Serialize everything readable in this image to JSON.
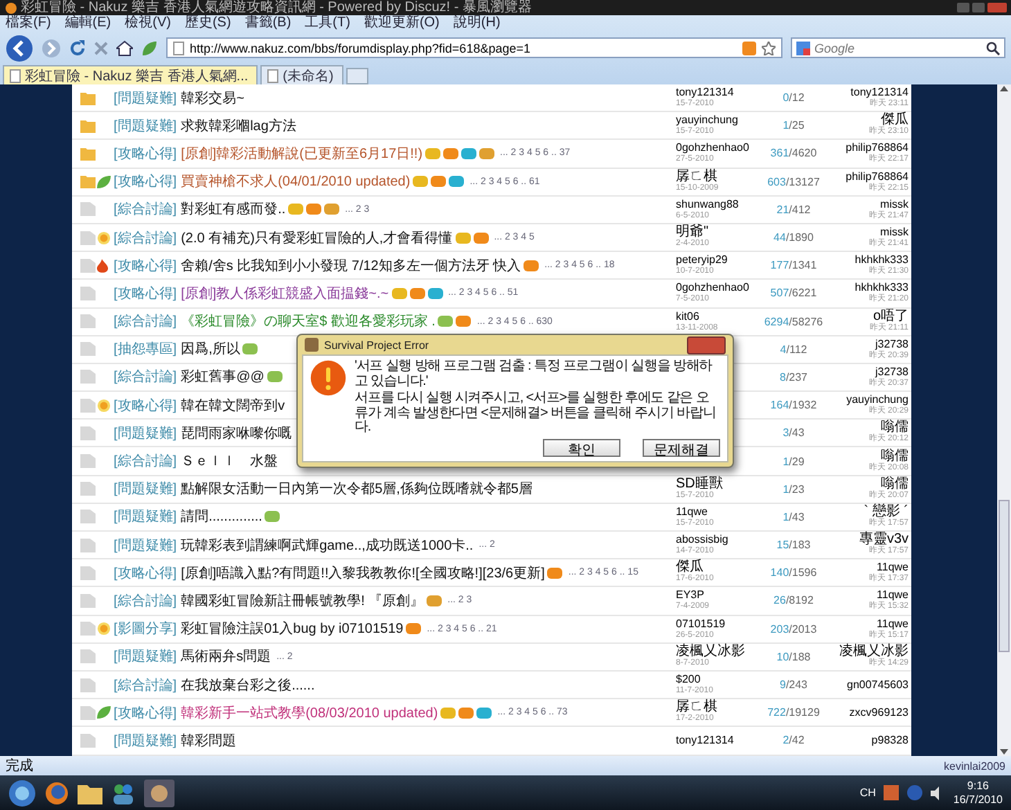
{
  "window": {
    "title": "彩虹冒險 - Nakuz 樂吉 香港人氣網遊攻略資訊網 - Powered by Discuz! - 暴風瀏覽器"
  },
  "menu": [
    "檔案(F)",
    "編輯(E)",
    "檢視(V)",
    "歷史(S)",
    "書籤(B)",
    "工具(T)",
    "歡迎更新(O)",
    "說明(H)"
  ],
  "address": {
    "value": "http://www.nakuz.com/bbs/forumdisplay.php?fid=618&page=1"
  },
  "search": {
    "placeholder": "Google"
  },
  "tabs": [
    {
      "label": "彩虹冒險 - Nakuz 樂吉 香港人氣網...",
      "selected": true
    },
    {
      "label": "(未命名)",
      "selected": false
    }
  ],
  "rows": [
    {
      "kind": "hot",
      "category": "[問題疑難]",
      "title": "韓彩交易~",
      "author": "tony121314",
      "date": "15-7-2010",
      "replies": "0",
      "views": "/12",
      "last_user": "tony121314",
      "last_time": "昨天 23:11"
    },
    {
      "kind": "hot",
      "category": "[問題疑難]",
      "title": "求救韓彩嗰lag方法",
      "author": "yauyinchung",
      "date": "15-7-2010",
      "replies": "1",
      "views": "/25",
      "last_user": "傑瓜",
      "last_time": "昨天 23:10"
    },
    {
      "kind": "hot",
      "category": "[攻略心得]",
      "title": "[原創]韓彩活動解說(已更新至6月17日!!)",
      "color": "#b5542a",
      "badges": [
        {
          "kind": "hot"
        },
        {
          "kind": "rate"
        },
        {
          "kind": "digest"
        },
        {
          "kind": "reward"
        }
      ],
      "pages": "... 2 3 4 5 6 .. 37",
      "author": "0gohzhenhao0",
      "date": "27-5-2010",
      "replies": "361",
      "views": "/4620",
      "last_user": "philip768864",
      "last_time": "昨天 22:17"
    },
    {
      "kind": "hot",
      "emblem": {
        "kind": "leaf"
      },
      "category": "[攻略心得]",
      "title": "買賣神槍不求人(04/01/2010 updated)",
      "color": "#b5542a",
      "badges": [
        {
          "kind": "hot"
        },
        {
          "kind": "rate"
        },
        {
          "kind": "digest"
        }
      ],
      "pages": "... 2 3 4 5 6 .. 61",
      "author": "孱ㄈ棋",
      "date": "15-10-2009",
      "replies": "603",
      "views": "/13127",
      "last_user": "philip768864",
      "last_time": "昨天 22:15"
    },
    {
      "kind": "normal",
      "category": "[綜合討論]",
      "title": "對彩虹有感而發..",
      "badges": [
        {
          "kind": "hot"
        },
        {
          "kind": "rate"
        },
        {
          "kind": "reward"
        }
      ],
      "pages": "... 2 3",
      "author": "shunwang88",
      "date": "6-5-2010",
      "replies": "21",
      "views": "/412",
      "last_user": "missk",
      "last_time": "昨天 21:47"
    },
    {
      "kind": "normal",
      "emblem": {
        "kind": "sun"
      },
      "category": "[綜合討論]",
      "title": "(2.0 有補充)只有愛彩虹冒險的人,才會看得懂",
      "badges": [
        {
          "kind": "hot"
        },
        {
          "kind": "rate"
        }
      ],
      "pages": "... 2 3 4 5",
      "author": "明爺\"",
      "date": "2-4-2010",
      "replies": "44",
      "views": "/1890",
      "last_user": "missk",
      "last_time": "昨天 21:41"
    },
    {
      "kind": "normal",
      "emblem": {
        "kind": "fire"
      },
      "category": "[攻略心得]",
      "title": "舍賴/舍s 比我知到小小發現 7/12知多左一個方法牙 快入",
      "badges": [
        {
          "kind": "rate"
        }
      ],
      "pages": "... 2 3 4 5 6 .. 18",
      "author": "peteryip29",
      "date": "10-7-2010",
      "replies": "177",
      "views": "/1341",
      "last_user": "hkhkhk333",
      "last_time": "昨天 21:30"
    },
    {
      "kind": "normal",
      "category": "[攻略心得]",
      "title": "[原創]教人係彩虹競盛入面揾錢~.~",
      "color": "#8a3a9a",
      "badges": [
        {
          "kind": "hot"
        },
        {
          "kind": "rate"
        },
        {
          "kind": "digest"
        }
      ],
      "pages": "... 2 3 4 5 6 .. 51",
      "author": "0gohzhenhao0",
      "date": "7-5-2010",
      "replies": "507",
      "views": "/6221",
      "last_user": "hkhkhk333",
      "last_time": "昨天 21:20"
    },
    {
      "kind": "normal",
      "category": "[綜合討論]",
      "title": "《彩虹冒險》の聊天室$ 歡迎各愛彩玩家 .",
      "color": "#2a8a2a",
      "badges": [
        {
          "kind": "image"
        },
        {
          "kind": "rate"
        }
      ],
      "pages": "... 2 3 4 5 6 .. 630",
      "author": "kit06",
      "date": "13-11-2008",
      "replies": "6294",
      "views": "/58276",
      "last_user": "o唔了",
      "last_time": "昨天 21:11"
    },
    {
      "kind": "normal",
      "category": "[抽怨專區]",
      "title": "因爲,所以",
      "badges": [
        {
          "kind": "image"
        }
      ],
      "replies": "4",
      "views": "/112",
      "last_user": "j32738",
      "last_time": "昨天 20:39"
    },
    {
      "kind": "normal",
      "category": "[綜合討論]",
      "title": "彩虹舊事@@",
      "badges": [
        {
          "kind": "image"
        }
      ],
      "replies": "8",
      "views": "/237",
      "last_user": "j32738",
      "last_time": "昨天 20:37"
    },
    {
      "kind": "normal",
      "emblem": {
        "kind": "sun"
      },
      "category": "[攻略心得]",
      "title": "韓在韓文闊帝到v",
      "replies": "164",
      "views": "/1932",
      "last_user": "yauyinchung",
      "last_time": "昨天 20:29"
    },
    {
      "kind": "normal",
      "category": "[問題疑難]",
      "title": "琵問雨家咻嚟你嘅",
      "replies": "3",
      "views": "/43",
      "last_user": "嗡儒",
      "last_time": "昨天 20:12"
    },
    {
      "kind": "normal",
      "category": "[綜合討論]",
      "title": "Ｓｅｌｌ　水盤",
      "replies": "1",
      "views": "/29",
      "last_user": "嗡儒",
      "last_time": "昨天 20:08"
    },
    {
      "kind": "normal",
      "category": "[問題疑難]",
      "title": "點解限女活動一日內第一次令都5層,係夠位既嗜就令都5層",
      "author": "SD睡獸",
      "date": "15-7-2010",
      "replies": "1",
      "views": "/23",
      "last_user": "嗡儒",
      "last_time": "昨天 20:07"
    },
    {
      "kind": "normal",
      "category": "[問題疑難]",
      "title": "請問..............",
      "badges": [
        {
          "kind": "image"
        }
      ],
      "author": "11qwe",
      "date": "15-7-2010",
      "replies": "1",
      "views": "/43",
      "last_user": "` 戀影 ´",
      "last_time": "昨天 17:57"
    },
    {
      "kind": "normal",
      "category": "[問題疑難]",
      "title": "玩韓彩表到謂練啊武輝game..,成功既送1000卡..",
      "pages": "... 2",
      "author": "abossisbig",
      "date": "14-7-2010",
      "replies": "15",
      "views": "/183",
      "last_user": "專靈v3v",
      "last_time": "昨天 17:57"
    },
    {
      "kind": "normal",
      "category": "[攻略心得]",
      "title": "[原創]唔識入點?有問題!!入黎我教教你![全國攻略!][23/6更新]",
      "badges": [
        {
          "kind": "rate"
        }
      ],
      "pages": "... 2 3 4 5 6 .. 15",
      "author": "傑瓜",
      "date": "17-6-2010",
      "replies": "140",
      "views": "/1596",
      "last_user": "11qwe",
      "last_time": "昨天 17:37"
    },
    {
      "kind": "normal",
      "category": "[綜合討論]",
      "title": "韓國彩虹冒險新註冊帳號教學! 『原創』",
      "badges": [
        {
          "kind": "reward"
        }
      ],
      "pages": "... 2 3",
      "author": "EY3P",
      "date": "7-4-2009",
      "replies": "26",
      "views": "/8192",
      "last_user": "11qwe",
      "last_time": "昨天 15:32"
    },
    {
      "kind": "normal",
      "emblem": {
        "kind": "sun"
      },
      "category": "[影圖分享]",
      "title": "彩虹冒險注誤01入bug by i07101519",
      "badges": [
        {
          "kind": "rate"
        }
      ],
      "pages": "... 2 3 4 5 6 .. 21",
      "author": "07101519",
      "date": "26-5-2010",
      "replies": "203",
      "views": "/2013",
      "last_user": "11qwe",
      "last_time": "昨天 15:17"
    },
    {
      "kind": "normal",
      "category": "[問題疑難]",
      "title": "馬術兩弁s問題",
      "pages": "... 2",
      "author": "凌楓乂冰影",
      "date": "8-7-2010",
      "replies": "10",
      "views": "/188",
      "last_user": "凌楓乂冰影",
      "last_time": "昨天 14:29"
    },
    {
      "kind": "normal",
      "category": "[綜合討論]",
      "title": "在我放棄台彩之後......",
      "author": "$200",
      "date": "11-7-2010",
      "replies": "9",
      "views": "/243",
      "last_user": "gn00745603"
    },
    {
      "kind": "normal",
      "emblem": {
        "kind": "leaf"
      },
      "category": "[攻略心得]",
      "title": "韓彩新手一站式教學(08/03/2010 updated)",
      "color": "#c0307a",
      "badges": [
        {
          "kind": "hot"
        },
        {
          "kind": "rate"
        },
        {
          "kind": "digest"
        }
      ],
      "pages": "... 2 3 4 5 6 .. 73",
      "author": "孱ㄈ棋",
      "date": "17-2-2010",
      "replies": "722",
      "views": "/19129",
      "last_user": "zxcv969123"
    },
    {
      "kind": "normal",
      "category": "[問題疑難]",
      "title": "韓彩問題",
      "author": "tony121314",
      "replies": "2",
      "views": "/42",
      "last_user": "p98328"
    }
  ],
  "dialog": {
    "title": "Survival Project Error",
    "message": "'서프 실행 방해 프로그램 검출 : 특정 프로그램이 실행을 방해하고 있습니다.'",
    "detail": "서프를 다시 실행 시켜주시고, <서프>를 실행한 후에도 같은 오류가 계속 발생한다면 <문제해결> 버튼을 클릭해 주시기 바랍니다.",
    "buttons": [
      "확인",
      "문제해결"
    ]
  },
  "status_bar": {
    "text": "完成",
    "user": "kevinlai2009"
  },
  "taskbar": {
    "language": "CH",
    "time": "9:16",
    "date": "16/7/2010"
  }
}
